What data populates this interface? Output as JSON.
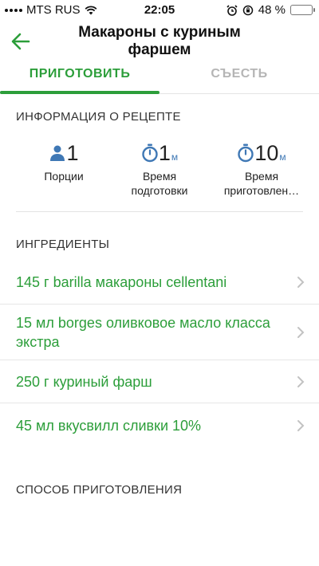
{
  "status_bar": {
    "carrier": "MTS RUS",
    "time": "22:05",
    "battery_percent": "48 %",
    "battery_level": 0.48,
    "battery_color": "#f5c61b"
  },
  "header": {
    "title": "Макароны с куриным фаршем"
  },
  "tabs": [
    {
      "label": "ПРИГОТОВИТЬ",
      "active": true
    },
    {
      "label": "СЪЕСТЬ",
      "active": false
    }
  ],
  "info": {
    "section_title": "ИНФОРМАЦИЯ О РЕЦЕПТЕ",
    "items": [
      {
        "icon": "person-icon",
        "value": "1",
        "unit": "",
        "label_line1": "Порции",
        "label_line2": ""
      },
      {
        "icon": "stopwatch-icon",
        "value": "1",
        "unit": "м",
        "label_line1": "Время",
        "label_line2": "подготовки"
      },
      {
        "icon": "stopwatch-icon",
        "value": "10",
        "unit": "м",
        "label_line1": "Время",
        "label_line2": "приготовлен…"
      }
    ]
  },
  "ingredients": {
    "section_title": "ИНГРЕДИЕНТЫ",
    "items": [
      "145 г barilla макароны cellentani",
      "15 мл borges оливковое масло класса экстра",
      "250 г куриный фарш",
      "45 мл вкусвилл сливки 10%"
    ]
  },
  "method": {
    "section_title": "СПОСОБ ПРИГОТОВЛЕНИЯ"
  },
  "colors": {
    "accent": "#2c9e3a",
    "inactive_tab": "#b5b5b5",
    "icon_blue": "#3f78b5"
  }
}
